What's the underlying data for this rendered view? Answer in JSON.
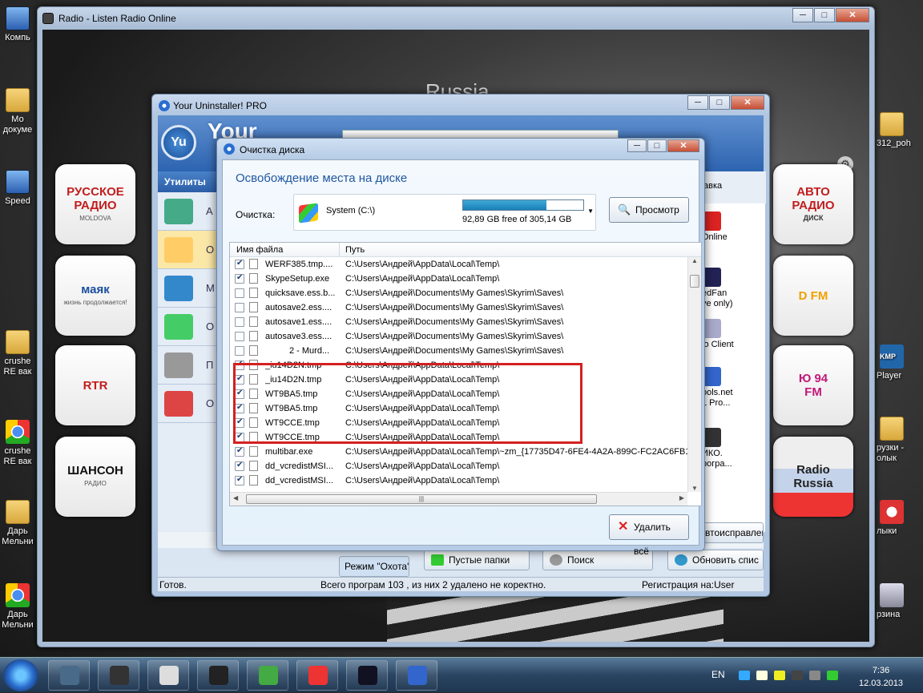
{
  "desktop": {
    "icons_left": [
      {
        "label": "Компь"
      },
      {
        "label": "Мо\nдокуме"
      },
      {
        "label": "Speed"
      },
      {
        "label": "crushe\nRE вак"
      },
      {
        "label": "crushe\nRE вак"
      },
      {
        "label": "Дарь\nМельни"
      },
      {
        "label": "Дарь\nМельни"
      }
    ],
    "icons_right": [
      {
        "label": "312_poh"
      },
      {
        "label": "Player"
      },
      {
        "label": "рузки -\nолык"
      },
      {
        "label": "лыки"
      },
      {
        "label": "рзина"
      }
    ]
  },
  "radio_window": {
    "title": "Radio - Listen Radio Online",
    "country": "Russia",
    "stations_left": [
      {
        "name": "РУССКОЕ\nРАДИО",
        "sub": "MOLDOVA",
        "color": "#c21d1d"
      },
      {
        "name": "маяк",
        "sub": "жизнь продолжается!",
        "color": "#1b4fa0"
      },
      {
        "name": "RTR",
        "sub": "",
        "color": "#c21d1d"
      },
      {
        "name": "ШАНСОН",
        "sub": "РАДИО",
        "color": "#111111"
      }
    ],
    "stations_right": [
      {
        "name": "АВТО\nРАДИО",
        "sub": "ДИСК",
        "color": "#c21d1d"
      },
      {
        "name": "D FM",
        "sub": "",
        "color": "#f0a000"
      },
      {
        "name": "Ю 94\nFM",
        "sub": "",
        "color": "#c2187a"
      },
      {
        "name": "Radio\nRussia",
        "sub": "",
        "color": "#222222"
      }
    ]
  },
  "uninstaller_window": {
    "title": "Your Uninstaller! PRO",
    "brand": "Your",
    "logo_text": "Yu",
    "sidebar_header": "Утилиты",
    "sidebar_items": [
      "А",
      "О",
      "М",
      "О",
      "П",
      "О"
    ],
    "right_tab": "авка",
    "right_items": [
      "Online",
      "edFan\nve only)",
      "lo Client",
      "ools.net\n1 Pro...",
      "ИКО.\nрогра..."
    ],
    "buttons": {
      "autofix": "втоисправлен",
      "hunt_mode": "Режим \"Охота\"",
      "empty_folders": "Пустые папки",
      "search": "Поиск",
      "refresh": "Обновить спис"
    },
    "status": {
      "ready": "Готов.",
      "total": "Всего програм 103 , из них 2 удалено не коректно.",
      "registration": "Регистрация на:User"
    }
  },
  "cleanup_dialog": {
    "title": "Очистка диска",
    "heading": "Освобождение места на диске",
    "cleanup_label": "Очистка:",
    "drive_label": "System (C:\\)",
    "free_text": "92,89 GB free of 305,14 GB",
    "used_fraction": 0.696,
    "browse_button": "Просмотр",
    "delete_all_button": "Удалить всё",
    "columns": {
      "name": "Имя файла",
      "path": "Путь"
    },
    "rows": [
      {
        "checked": true,
        "name": "WERF385.tmp....",
        "path": "C:\\Users\\Андрей\\AppData\\Local\\Temp\\"
      },
      {
        "checked": true,
        "name": "SkypeSetup.exe",
        "path": "C:\\Users\\Андрей\\AppData\\Local\\Temp\\"
      },
      {
        "checked": false,
        "name": "quicksave.ess.b...",
        "path": "C:\\Users\\Андрей\\Documents\\My Games\\Skyrim\\Saves\\"
      },
      {
        "checked": false,
        "name": "autosave2.ess....",
        "path": "C:\\Users\\Андрей\\Documents\\My Games\\Skyrim\\Saves\\"
      },
      {
        "checked": false,
        "name": "autosave1.ess....",
        "path": "C:\\Users\\Андрей\\Documents\\My Games\\Skyrim\\Saves\\"
      },
      {
        "checked": false,
        "name": "autosave3.ess....",
        "path": "C:\\Users\\Андрей\\Documents\\My Games\\Skyrim\\Saves\\"
      },
      {
        "checked": false,
        "name": "2 - Murd...",
        "path": "C:\\Users\\Андрей\\Documents\\My Games\\Skyrim\\Saves\\",
        "indent": true
      },
      {
        "checked": true,
        "name": "_iu14D2N.tmp",
        "path": "C:\\Users\\Андрей\\AppData\\Local\\Temp\\"
      },
      {
        "checked": true,
        "name": "_iu14D2N.tmp",
        "path": "C:\\Users\\Андрей\\AppData\\Local\\Temp\\"
      },
      {
        "checked": true,
        "name": "WT9BA5.tmp",
        "path": "C:\\Users\\Андрей\\AppData\\Local\\Temp\\"
      },
      {
        "checked": true,
        "name": "WT9BA5.tmp",
        "path": "C:\\Users\\Андрей\\AppData\\Local\\Temp\\"
      },
      {
        "checked": true,
        "name": "WT9CCE.tmp",
        "path": "C:\\Users\\Андрей\\AppData\\Local\\Temp\\"
      },
      {
        "checked": true,
        "name": "WT9CCE.tmp",
        "path": "C:\\Users\\Андрей\\AppData\\Local\\Temp\\"
      },
      {
        "checked": true,
        "name": "multibar.exe",
        "path": "C:\\Users\\Андрей\\AppData\\Local\\Temp\\~zm_{17735D47-6FE4-4A2A-899C-FC2AC6FB1"
      },
      {
        "checked": true,
        "name": "dd_vcredistMSI...",
        "path": "C:\\Users\\Андрей\\AppData\\Local\\Temp\\"
      },
      {
        "checked": true,
        "name": "dd_vcredistMSI...",
        "path": "C:\\Users\\Андрей\\AppData\\Local\\Temp\\"
      }
    ]
  },
  "taskbar": {
    "apps": [
      "winamp",
      "steam",
      "skyrim",
      "game",
      "utorrent",
      "chrome",
      "aion",
      "your-uninstaller"
    ],
    "lang": "EN",
    "time": "7:36",
    "date": "12.03.2013"
  }
}
